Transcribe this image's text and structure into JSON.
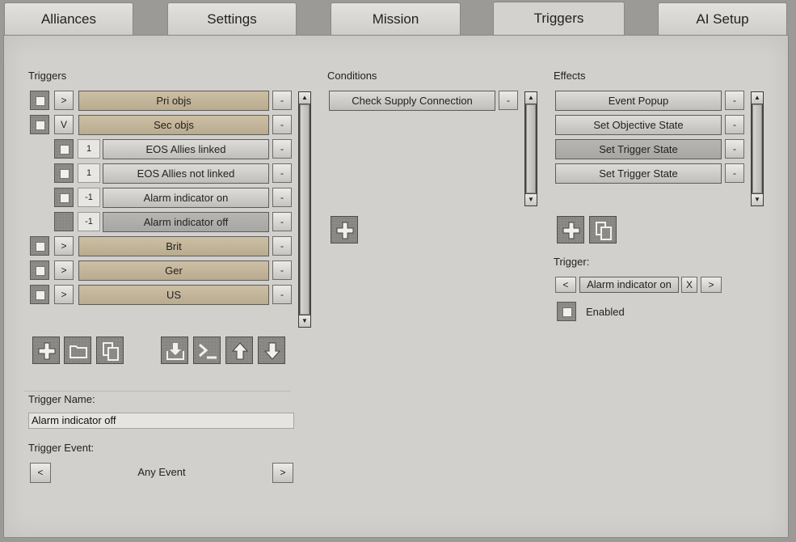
{
  "tabs": [
    "Alliances",
    "Settings",
    "Mission",
    "Triggers",
    "AI Setup"
  ],
  "active_tab": "Triggers",
  "triggers": {
    "header": "Triggers",
    "remove_label": "-",
    "rows": [
      {
        "expander": ">",
        "label": "Pri objs"
      },
      {
        "expander": "V",
        "label": "Sec objs"
      },
      {
        "order": "1",
        "label": "EOS Allies linked"
      },
      {
        "order": "1",
        "label": "EOS Allies not linked"
      },
      {
        "order": "-1",
        "label": "Alarm indicator on"
      },
      {
        "order": "-1",
        "label": "Alarm indicator off"
      },
      {
        "expander": ">",
        "label": "Brit"
      },
      {
        "expander": ">",
        "label": "Ger"
      },
      {
        "expander": ">",
        "label": "US"
      }
    ]
  },
  "conditions": {
    "header": "Conditions",
    "items": [
      "Check Supply Connection"
    ],
    "remove_label": "-"
  },
  "effects": {
    "header": "Effects",
    "items": [
      "Event Popup",
      "Set Objective State",
      "Set Trigger State",
      "Set Trigger State"
    ],
    "remove_label": "-"
  },
  "effect_trigger": {
    "label": "Trigger:",
    "prev": "<",
    "value": "Alarm indicator on",
    "clear": "X",
    "next": ">",
    "enabled_label": "Enabled"
  },
  "trigger_name": {
    "label": "Trigger Name:",
    "value": "Alarm indicator off"
  },
  "trigger_event": {
    "label": "Trigger Event:",
    "prev": "<",
    "value": "Any Event",
    "next": ">"
  },
  "scroll_up": "▲",
  "scroll_down": "▼",
  "icons": [
    "plus-icon",
    "folder-icon",
    "copy-icon",
    "import-icon",
    "terminal-icon",
    "arrow-up-icon",
    "arrow-down-icon"
  ]
}
